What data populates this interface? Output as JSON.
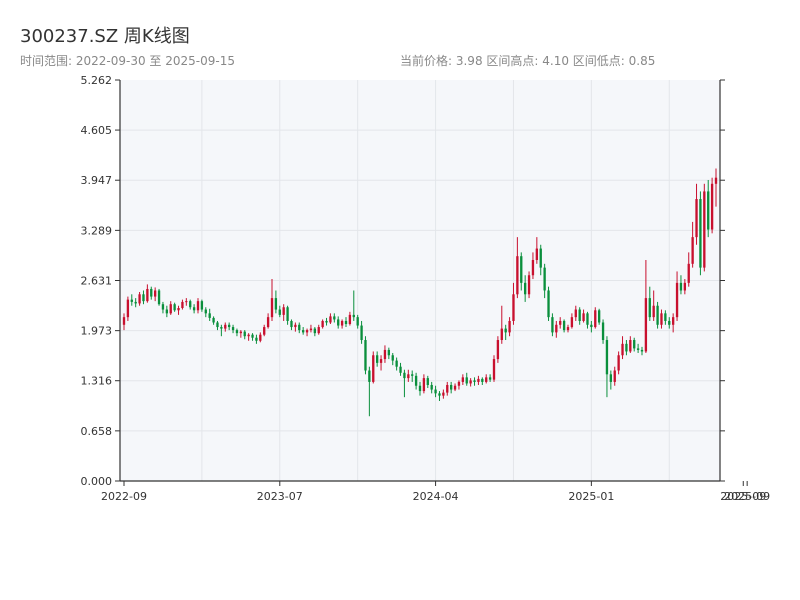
{
  "header": {
    "title": "300237.SZ 周K线图",
    "range_text": "时间范围: 2022-09-30 至 2025-09-15",
    "stats_text": "当前价格: 3.98   区间高点: 4.10   区间低点: 0.85"
  },
  "chart_data": {
    "type": "candlestick",
    "title": "300237.SZ 周K线图",
    "ylim": [
      0,
      5.262
    ],
    "yticks": [
      "0.000",
      "0.658",
      "1.316",
      "1.973",
      "2.631",
      "3.289",
      "3.947",
      "4.605",
      "5.262"
    ],
    "xticks": [
      {
        "label": "2022-09",
        "index": 0
      },
      {
        "label": "2023-07",
        "index": 40
      },
      {
        "label": "2024-04",
        "index": 80
      },
      {
        "label": "2025-01",
        "index": 120
      },
      {
        "label": "2025-09",
        "index": 159
      },
      {
        "label": "2025-09",
        "index": 160
      }
    ],
    "up_color": "#c8102e",
    "down_color": "#0a8f3c",
    "background": "#f5f7fa",
    "grid": true,
    "candles": [
      [
        2.05,
        2.2,
        1.98,
        2.15
      ],
      [
        2.15,
        2.42,
        2.1,
        2.38
      ],
      [
        2.38,
        2.45,
        2.3,
        2.35
      ],
      [
        2.35,
        2.4,
        2.28,
        2.33
      ],
      [
        2.33,
        2.48,
        2.3,
        2.45
      ],
      [
        2.45,
        2.5,
        2.32,
        2.36
      ],
      [
        2.36,
        2.58,
        2.34,
        2.52
      ],
      [
        2.52,
        2.55,
        2.38,
        2.42
      ],
      [
        2.42,
        2.54,
        2.36,
        2.5
      ],
      [
        2.5,
        2.52,
        2.3,
        2.32
      ],
      [
        2.32,
        2.35,
        2.2,
        2.25
      ],
      [
        2.25,
        2.3,
        2.15,
        2.2
      ],
      [
        2.2,
        2.36,
        2.18,
        2.32
      ],
      [
        2.32,
        2.34,
        2.22,
        2.24
      ],
      [
        2.24,
        2.3,
        2.18,
        2.27
      ],
      [
        2.27,
        2.38,
        2.25,
        2.35
      ],
      [
        2.35,
        2.4,
        2.3,
        2.36
      ],
      [
        2.36,
        2.38,
        2.25,
        2.28
      ],
      [
        2.28,
        2.32,
        2.2,
        2.24
      ],
      [
        2.24,
        2.4,
        2.2,
        2.36
      ],
      [
        2.36,
        2.38,
        2.22,
        2.25
      ],
      [
        2.25,
        2.28,
        2.15,
        2.2
      ],
      [
        2.2,
        2.26,
        2.1,
        2.14
      ],
      [
        2.14,
        2.16,
        2.05,
        2.08
      ],
      [
        2.08,
        2.1,
        1.98,
        2.02
      ],
      [
        2.02,
        2.05,
        1.9,
        2.0
      ],
      [
        2.0,
        2.08,
        1.96,
        2.05
      ],
      [
        2.05,
        2.08,
        1.98,
        2.02
      ],
      [
        2.02,
        2.05,
        1.94,
        1.98
      ],
      [
        1.98,
        2.0,
        1.9,
        1.94
      ],
      [
        1.94,
        1.98,
        1.88,
        1.96
      ],
      [
        1.96,
        1.98,
        1.86,
        1.9
      ],
      [
        1.9,
        1.94,
        1.84,
        1.92
      ],
      [
        1.92,
        1.94,
        1.84,
        1.88
      ],
      [
        1.88,
        1.92,
        1.8,
        1.84
      ],
      [
        1.84,
        1.95,
        1.82,
        1.92
      ],
      [
        1.92,
        2.05,
        1.9,
        2.02
      ],
      [
        2.02,
        2.2,
        2.0,
        2.15
      ],
      [
        2.15,
        2.65,
        2.1,
        2.4
      ],
      [
        2.4,
        2.5,
        2.2,
        2.25
      ],
      [
        2.25,
        2.3,
        2.15,
        2.18
      ],
      [
        2.18,
        2.32,
        2.1,
        2.28
      ],
      [
        2.28,
        2.3,
        2.05,
        2.1
      ],
      [
        2.1,
        2.12,
        1.98,
        2.02
      ],
      [
        2.02,
        2.08,
        1.96,
        2.05
      ],
      [
        2.05,
        2.08,
        1.94,
        1.98
      ],
      [
        1.98,
        2.02,
        1.92,
        1.95
      ],
      [
        1.95,
        2.0,
        1.9,
        1.98
      ],
      [
        1.98,
        2.05,
        1.95,
        2.0
      ],
      [
        2.0,
        2.02,
        1.9,
        1.94
      ],
      [
        1.94,
        2.05,
        1.92,
        2.02
      ],
      [
        2.02,
        2.12,
        2.0,
        2.1
      ],
      [
        2.1,
        2.14,
        2.04,
        2.08
      ],
      [
        2.08,
        2.2,
        2.06,
        2.16
      ],
      [
        2.16,
        2.2,
        2.08,
        2.12
      ],
      [
        2.12,
        2.16,
        2.0,
        2.04
      ],
      [
        2.04,
        2.12,
        2.0,
        2.1
      ],
      [
        2.1,
        2.15,
        2.02,
        2.06
      ],
      [
        2.06,
        2.22,
        2.04,
        2.18
      ],
      [
        2.18,
        2.5,
        2.1,
        2.15
      ],
      [
        2.15,
        2.18,
        2.0,
        2.04
      ],
      [
        2.04,
        2.1,
        1.8,
        1.85
      ],
      [
        1.85,
        1.9,
        1.4,
        1.45
      ],
      [
        1.45,
        1.5,
        0.85,
        1.3
      ],
      [
        1.3,
        1.7,
        1.28,
        1.65
      ],
      [
        1.65,
        1.7,
        1.5,
        1.55
      ],
      [
        1.55,
        1.65,
        1.45,
        1.6
      ],
      [
        1.6,
        1.78,
        1.55,
        1.72
      ],
      [
        1.72,
        1.75,
        1.6,
        1.65
      ],
      [
        1.65,
        1.68,
        1.52,
        1.58
      ],
      [
        1.58,
        1.62,
        1.45,
        1.5
      ],
      [
        1.5,
        1.55,
        1.38,
        1.42
      ],
      [
        1.42,
        1.46,
        1.1,
        1.35
      ],
      [
        1.35,
        1.46,
        1.3,
        1.4
      ],
      [
        1.4,
        1.45,
        1.3,
        1.38
      ],
      [
        1.38,
        1.42,
        1.2,
        1.25
      ],
      [
        1.25,
        1.3,
        1.12,
        1.18
      ],
      [
        1.18,
        1.4,
        1.15,
        1.35
      ],
      [
        1.35,
        1.38,
        1.22,
        1.26
      ],
      [
        1.26,
        1.3,
        1.15,
        1.2
      ],
      [
        1.2,
        1.25,
        1.1,
        1.15
      ],
      [
        1.15,
        1.18,
        1.05,
        1.12
      ],
      [
        1.12,
        1.2,
        1.08,
        1.16
      ],
      [
        1.16,
        1.3,
        1.12,
        1.26
      ],
      [
        1.26,
        1.3,
        1.15,
        1.2
      ],
      [
        1.2,
        1.28,
        1.18,
        1.25
      ],
      [
        1.25,
        1.32,
        1.2,
        1.3
      ],
      [
        1.3,
        1.4,
        1.26,
        1.36
      ],
      [
        1.36,
        1.42,
        1.25,
        1.28
      ],
      [
        1.28,
        1.35,
        1.24,
        1.32
      ],
      [
        1.32,
        1.36,
        1.25,
        1.3
      ],
      [
        1.3,
        1.38,
        1.26,
        1.34
      ],
      [
        1.34,
        1.36,
        1.26,
        1.3
      ],
      [
        1.3,
        1.4,
        1.28,
        1.36
      ],
      [
        1.36,
        1.4,
        1.3,
        1.33
      ],
      [
        1.33,
        1.65,
        1.3,
        1.6
      ],
      [
        1.6,
        1.9,
        1.55,
        1.85
      ],
      [
        1.85,
        2.3,
        1.8,
        2.0
      ],
      [
        2.0,
        2.05,
        1.85,
        1.95
      ],
      [
        1.95,
        2.15,
        1.9,
        2.1
      ],
      [
        2.1,
        2.6,
        2.05,
        2.45
      ],
      [
        2.45,
        3.2,
        2.4,
        2.95
      ],
      [
        2.95,
        3.0,
        2.5,
        2.6
      ],
      [
        2.6,
        2.7,
        2.35,
        2.45
      ],
      [
        2.45,
        2.75,
        2.4,
        2.7
      ],
      [
        2.7,
        3.0,
        2.65,
        2.9
      ],
      [
        2.9,
        3.2,
        2.85,
        3.05
      ],
      [
        3.05,
        3.1,
        2.7,
        2.8
      ],
      [
        2.8,
        2.85,
        2.4,
        2.5
      ],
      [
        2.5,
        2.55,
        2.1,
        2.15
      ],
      [
        2.15,
        2.2,
        1.9,
        1.95
      ],
      [
        1.95,
        2.1,
        1.88,
        2.05
      ],
      [
        2.05,
        2.15,
        2.0,
        2.1
      ],
      [
        2.1,
        2.12,
        1.95,
        1.98
      ],
      [
        1.98,
        2.05,
        1.95,
        2.02
      ],
      [
        2.02,
        2.2,
        2.0,
        2.15
      ],
      [
        2.15,
        2.3,
        2.1,
        2.25
      ],
      [
        2.25,
        2.28,
        2.05,
        2.1
      ],
      [
        2.1,
        2.25,
        2.08,
        2.2
      ],
      [
        2.2,
        2.22,
        2.0,
        2.05
      ],
      [
        2.05,
        2.1,
        1.95,
        2.02
      ],
      [
        2.02,
        2.28,
        2.0,
        2.24
      ],
      [
        2.24,
        2.26,
        2.05,
        2.08
      ],
      [
        2.08,
        2.12,
        1.8,
        1.85
      ],
      [
        1.85,
        1.9,
        1.1,
        1.4
      ],
      [
        1.4,
        1.45,
        1.2,
        1.3
      ],
      [
        1.3,
        1.5,
        1.25,
        1.45
      ],
      [
        1.45,
        1.7,
        1.4,
        1.65
      ],
      [
        1.65,
        1.9,
        1.6,
        1.8
      ],
      [
        1.8,
        1.85,
        1.65,
        1.7
      ],
      [
        1.7,
        1.9,
        1.68,
        1.85
      ],
      [
        1.85,
        1.88,
        1.7,
        1.74
      ],
      [
        1.74,
        1.8,
        1.68,
        1.72
      ],
      [
        1.72,
        1.76,
        1.65,
        1.7
      ],
      [
        1.7,
        2.9,
        1.68,
        2.4
      ],
      [
        2.4,
        2.55,
        2.1,
        2.15
      ],
      [
        2.15,
        2.5,
        2.1,
        2.3
      ],
      [
        2.3,
        2.35,
        2.0,
        2.05
      ],
      [
        2.05,
        2.25,
        2.0,
        2.2
      ],
      [
        2.2,
        2.24,
        2.05,
        2.1
      ],
      [
        2.1,
        2.15,
        2.0,
        2.05
      ],
      [
        2.05,
        2.2,
        1.95,
        2.15
      ],
      [
        2.15,
        2.75,
        2.1,
        2.6
      ],
      [
        2.6,
        2.7,
        2.45,
        2.5
      ],
      [
        2.5,
        2.65,
        2.45,
        2.6
      ],
      [
        2.6,
        3.0,
        2.55,
        2.85
      ],
      [
        2.85,
        3.4,
        2.8,
        3.2
      ],
      [
        3.2,
        3.9,
        3.1,
        3.7
      ],
      [
        3.7,
        3.8,
        2.7,
        2.8
      ],
      [
        2.8,
        3.9,
        2.75,
        3.8
      ],
      [
        3.8,
        3.95,
        3.2,
        3.3
      ],
      [
        3.3,
        3.98,
        3.25,
        3.9
      ],
      [
        3.9,
        4.1,
        3.6,
        3.98
      ]
    ]
  }
}
